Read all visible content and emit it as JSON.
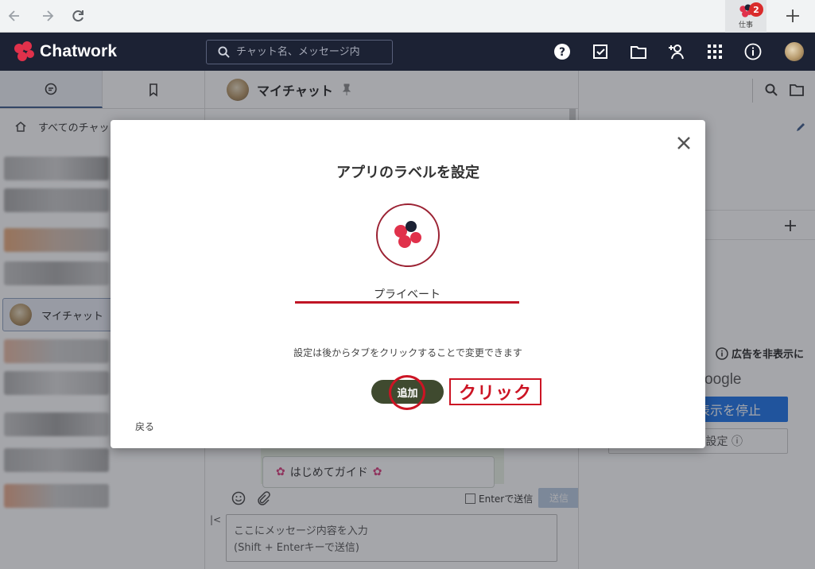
{
  "browser": {
    "app_tab_label": "仕事",
    "app_tab_badge": "2"
  },
  "header": {
    "logo_text": "Chatwork",
    "search_placeholder": "チャット名、メッセージ内"
  },
  "sidebar": {
    "all_chats_label": "すべてのチャット",
    "selected_room": "マイチャット"
  },
  "chat": {
    "room_title": "マイチャット",
    "guide_card_text": "はじめてガイド",
    "enter_send_label": "Enterで送信",
    "send_button": "送信",
    "message_placeholder_line1": "ここにメッセージ内容を入力",
    "message_placeholder_line2": "(Shift + Enterキーで送信)"
  },
  "right_panel": {
    "ad_hide_label": "広告を非表示に",
    "ad_google": "oogle",
    "ad_stop_label": "表示を停止",
    "ad_settings_label": "設定 ⓘ"
  },
  "modal": {
    "title": "アプリのラベルを設定",
    "label_value": "プライベート",
    "hint": "設定は後からタブをクリックすることで変更できます",
    "add_button": "追加",
    "back_link": "戻る",
    "callout": "クリック"
  },
  "colors": {
    "header_bg": "#1c2234",
    "brand_red": "#e0314b",
    "brand_navy": "#1c2234",
    "add_button_bg": "#3f4a2f",
    "annotation_red": "#cc1424",
    "ad_blue": "#1a73e8"
  }
}
